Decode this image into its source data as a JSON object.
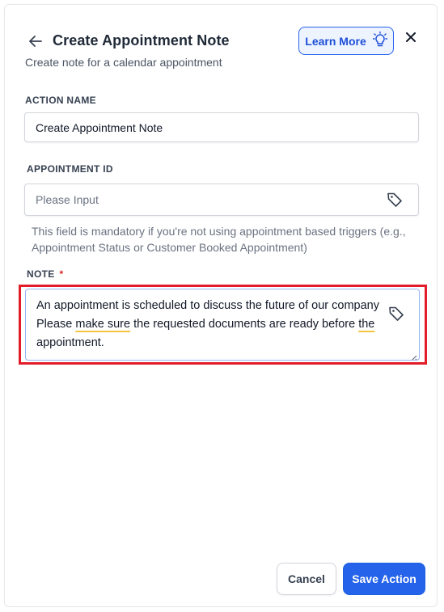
{
  "header": {
    "title": "Create Appointment Note",
    "subtitle": "Create note for a calendar appointment",
    "learn_more_label": "Learn More"
  },
  "fields": {
    "action_name": {
      "label": "ACTION NAME",
      "value": "Create Appointment Note"
    },
    "appointment_id": {
      "label": "APPOINTMENT ID",
      "placeholder": "Please Input",
      "helper": "This field is mandatory if you're not using appointment based triggers (e.g., Appointment Status or Customer Booked Appointment)"
    },
    "note": {
      "label": "NOTE",
      "required_marker": "*",
      "line1": "An appointment is scheduled to discuss the future of our company",
      "line2_a": "Please ",
      "line2_b": "make sure",
      "line2_c": " the requested documents are ready before ",
      "line2_d": "the",
      "line3": "appointment."
    }
  },
  "footer": {
    "cancel_label": "Cancel",
    "save_label": "Save Action"
  },
  "colors": {
    "accent": "#2563eb",
    "highlight_border": "#e11d2a",
    "required": "#dc2626"
  },
  "icons": [
    "arrow-left-icon",
    "lightbulb-icon",
    "close-icon",
    "tag-icon",
    "resize-handle-icon"
  ]
}
